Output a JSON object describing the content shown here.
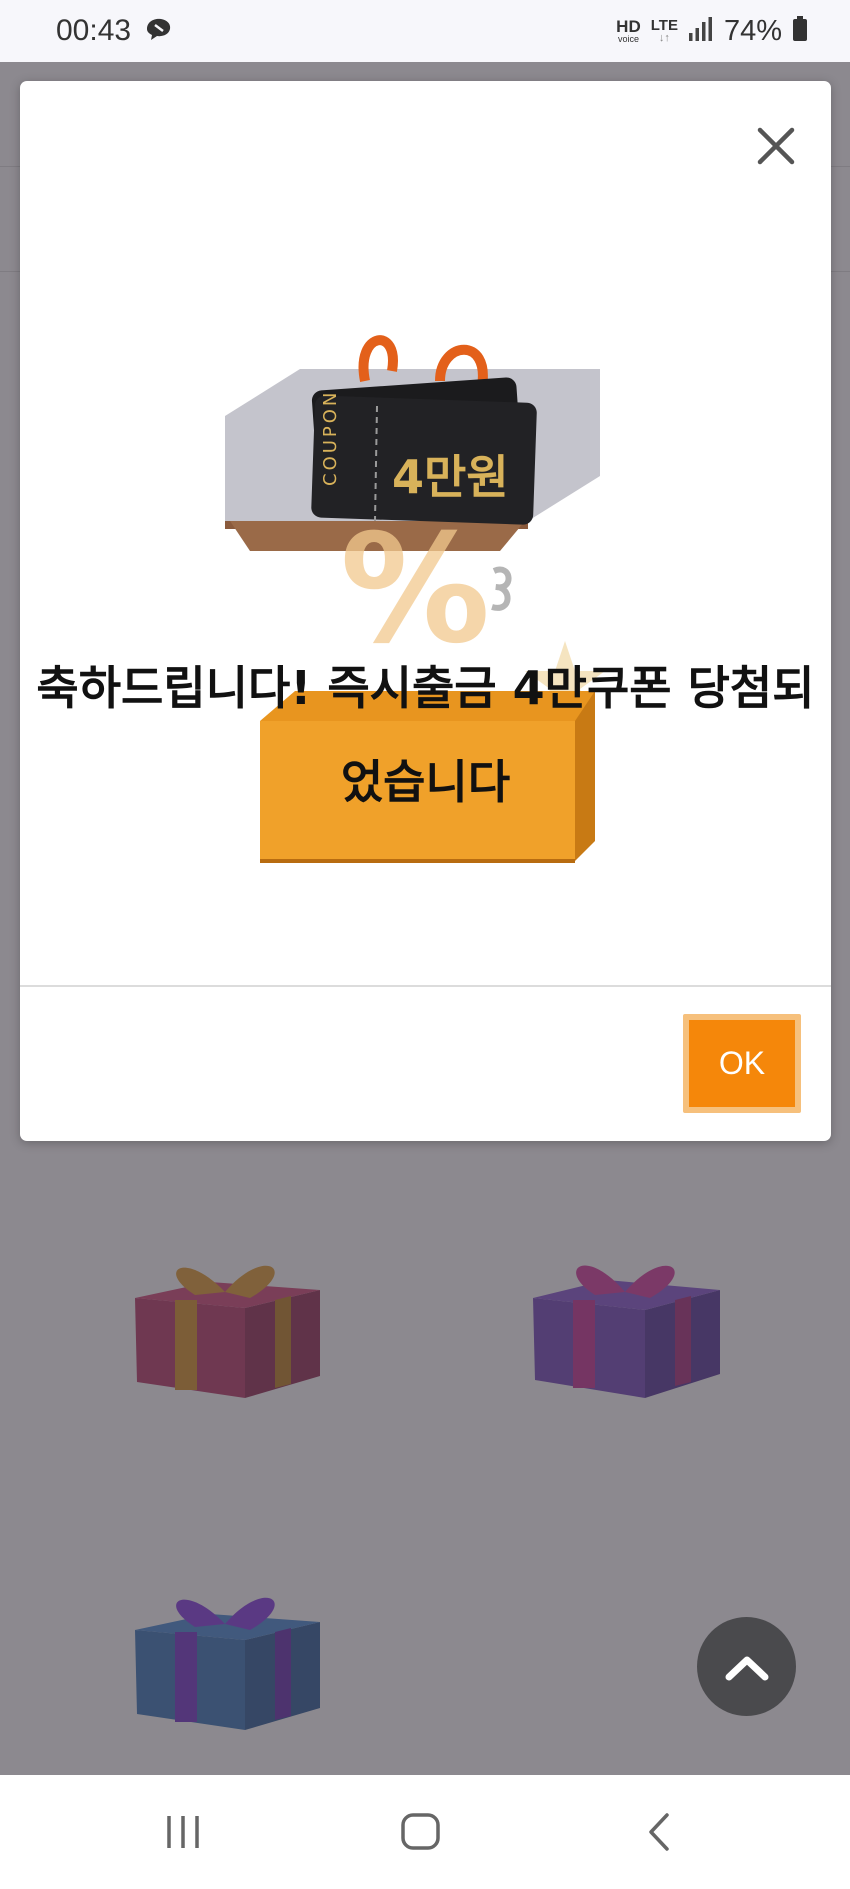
{
  "status_bar": {
    "time": "00:43",
    "hd_label": "HD",
    "hd_sub": "voice",
    "lte_label": "LTE",
    "lte_sub": "↓↑",
    "battery": "74%"
  },
  "modal": {
    "coupon_side_text": "COUPON",
    "coupon_amount": "4만원",
    "message": "축하드립니다! 즉시출금 4만쿠폰 당첨되었습니다",
    "ok_label": "OK"
  },
  "gifts": [
    "red-gift",
    "purple-gift",
    "blue-gift"
  ],
  "colors": {
    "accent": "#f5870a",
    "accent_border": "#f6c07c",
    "overlay": "#46404a",
    "box_orange": "#e8951f",
    "coupon_gold": "#d8b25a"
  },
  "nav": {
    "recents_icon": "recent-apps-icon",
    "home_icon": "home-icon",
    "back_icon": "back-icon"
  }
}
